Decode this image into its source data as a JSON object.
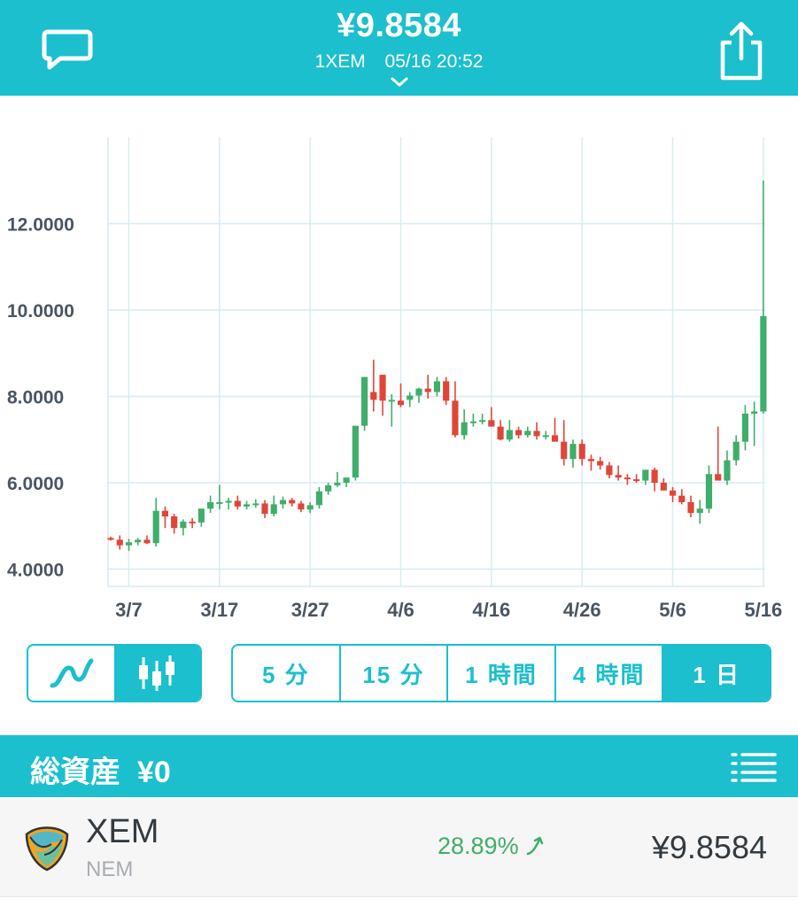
{
  "header": {
    "price": "¥9.8584",
    "pair": "1XEM",
    "datetime": "05/16 20:52",
    "colors": {
      "bar": "#1bbfcd",
      "text": "#ffffff"
    },
    "icons": [
      "chat-bubble-icon",
      "share-icon",
      "chevron-down-icon"
    ]
  },
  "chart_data": {
    "type": "candlestick",
    "x": [
      "3/5",
      "3/6",
      "3/7",
      "3/8",
      "3/9",
      "3/10",
      "3/11",
      "3/12",
      "3/13",
      "3/14",
      "3/15",
      "3/16",
      "3/17",
      "3/18",
      "3/19",
      "3/20",
      "3/21",
      "3/22",
      "3/23",
      "3/24",
      "3/25",
      "3/26",
      "3/27",
      "3/28",
      "3/29",
      "3/30",
      "3/31",
      "4/1",
      "4/2",
      "4/3",
      "4/4",
      "4/5",
      "4/6",
      "4/7",
      "4/8",
      "4/9",
      "4/10",
      "4/11",
      "4/12",
      "4/13",
      "4/14",
      "4/15",
      "4/16",
      "4/17",
      "4/18",
      "4/19",
      "4/20",
      "4/21",
      "4/22",
      "4/23",
      "4/24",
      "4/25",
      "4/26",
      "4/27",
      "4/28",
      "4/29",
      "4/30",
      "5/1",
      "5/2",
      "5/3",
      "5/4",
      "5/5",
      "5/6",
      "5/7",
      "5/8",
      "5/9",
      "5/10",
      "5/11",
      "5/12",
      "5/13",
      "5/14",
      "5/15",
      "5/16"
    ],
    "open": [
      4.72,
      4.68,
      4.55,
      4.62,
      4.68,
      4.6,
      5.35,
      5.22,
      4.95,
      5.1,
      5.08,
      5.4,
      5.55,
      5.55,
      5.58,
      5.45,
      5.5,
      5.52,
      5.28,
      5.5,
      5.6,
      5.52,
      5.38,
      5.48,
      5.8,
      5.94,
      6.0,
      6.12,
      7.32,
      8.1,
      8.5,
      7.92,
      7.9,
      7.92,
      8.02,
      8.18,
      8.1,
      8.35,
      7.9,
      7.1,
      7.4,
      7.42,
      7.45,
      7.3,
      7.0,
      7.22,
      7.1,
      7.2,
      7.08,
      7.1,
      6.95,
      6.55,
      6.9,
      6.55,
      6.5,
      6.4,
      6.18,
      6.12,
      6.08,
      6.05,
      6.3,
      6.0,
      5.82,
      5.7,
      5.55,
      5.3,
      5.4,
      6.2,
      6.05,
      6.52,
      6.95,
      7.6,
      7.65
    ],
    "high": [
      4.75,
      4.78,
      4.7,
      4.72,
      4.78,
      5.65,
      5.45,
      5.28,
      5.15,
      5.18,
      5.4,
      5.7,
      5.95,
      5.65,
      5.7,
      5.58,
      5.62,
      5.6,
      5.7,
      5.68,
      5.65,
      5.58,
      5.55,
      5.9,
      6.0,
      6.25,
      6.12,
      6.25,
      8.15,
      8.85,
      8.5,
      8.05,
      8.3,
      8.1,
      8.2,
      8.5,
      8.45,
      8.45,
      8.35,
      7.7,
      7.6,
      7.6,
      7.75,
      7.45,
      7.45,
      7.3,
      7.3,
      7.4,
      7.2,
      7.5,
      7.45,
      7.0,
      7.0,
      6.65,
      6.6,
      6.48,
      6.4,
      6.2,
      6.2,
      6.25,
      6.35,
      6.1,
      5.9,
      5.85,
      5.7,
      5.6,
      6.4,
      7.3,
      6.75,
      7.1,
      7.8,
      7.88,
      13.0
    ],
    "low": [
      4.66,
      4.45,
      4.42,
      4.55,
      4.58,
      4.52,
      4.95,
      4.82,
      4.78,
      4.95,
      4.98,
      5.3,
      5.38,
      5.38,
      5.38,
      5.38,
      5.42,
      5.18,
      5.22,
      5.4,
      5.45,
      5.32,
      5.3,
      5.4,
      5.72,
      5.9,
      5.9,
      6.05,
      7.2,
      7.65,
      7.55,
      7.3,
      7.75,
      7.75,
      7.85,
      7.95,
      8.0,
      7.8,
      7.05,
      7.0,
      7.3,
      7.35,
      7.4,
      6.98,
      6.95,
      7.02,
      7.05,
      7.0,
      7.0,
      7.0,
      6.4,
      6.35,
      6.4,
      6.28,
      6.3,
      6.1,
      6.05,
      5.95,
      6.0,
      5.95,
      5.8,
      5.85,
      5.55,
      5.5,
      5.2,
      5.05,
      5.3,
      6.05,
      5.95,
      6.4,
      6.75,
      6.85,
      7.6
    ],
    "close": [
      4.68,
      4.55,
      4.62,
      4.68,
      4.6,
      5.35,
      5.22,
      4.95,
      5.1,
      5.08,
      5.4,
      5.55,
      5.55,
      5.58,
      5.45,
      5.5,
      5.52,
      5.28,
      5.5,
      5.6,
      5.52,
      5.38,
      5.48,
      5.8,
      5.94,
      6.0,
      6.12,
      7.32,
      8.45,
      7.92,
      7.9,
      7.92,
      7.8,
      8.02,
      8.18,
      8.1,
      8.35,
      7.9,
      7.1,
      7.4,
      7.42,
      7.45,
      7.3,
      7.0,
      7.22,
      7.1,
      7.2,
      7.08,
      7.1,
      6.95,
      6.55,
      6.9,
      6.55,
      6.5,
      6.4,
      6.18,
      6.12,
      6.08,
      6.05,
      6.3,
      6.0,
      5.82,
      5.7,
      5.55,
      5.3,
      5.4,
      6.2,
      6.05,
      6.52,
      6.95,
      7.6,
      7.65,
      9.86
    ],
    "xticks": [
      "3/7",
      "3/17",
      "3/27",
      "4/6",
      "4/16",
      "4/26",
      "5/6",
      "5/16"
    ],
    "yticks": [
      "4.0000",
      "6.0000",
      "8.0000",
      "10.0000",
      "12.0000"
    ],
    "ylim": [
      3.6,
      14.0
    ],
    "grid": true,
    "colors": {
      "up": "#3fae6a",
      "down": "#e0453a",
      "grid": "#d8ecf2"
    }
  },
  "chart_type_toggle": {
    "options": [
      "line-chart-icon",
      "candlestick-icon"
    ],
    "selected": "candlestick-icon"
  },
  "intervals": {
    "items": [
      "5 分",
      "15 分",
      "1 時間",
      "4 時間",
      "1 日"
    ],
    "selected": "1 日"
  },
  "assets": {
    "title": "総資産",
    "total": "¥0",
    "menu_icon": "list-menu-icon"
  },
  "holding": {
    "symbol": "XEM",
    "name": "NEM",
    "change": "28.89%",
    "change_icon": "trend-up-arrow-icon",
    "price": "¥9.8584",
    "logo_icon": "nem-logo-icon"
  }
}
